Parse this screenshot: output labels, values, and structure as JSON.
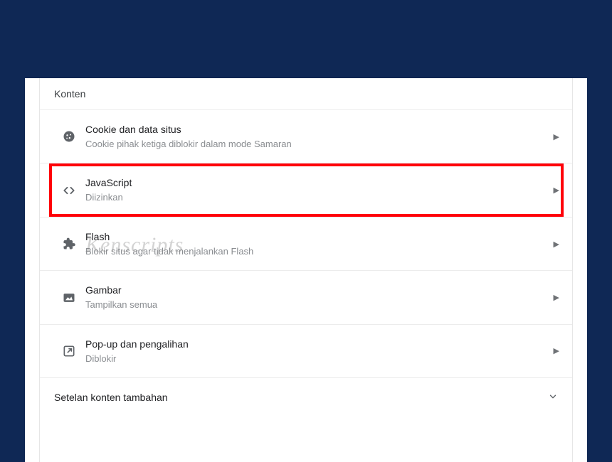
{
  "section": {
    "header": "Konten"
  },
  "items": [
    {
      "title": "Cookie dan data situs",
      "subtitle": "Cookie pihak ketiga diblokir dalam mode Samaran"
    },
    {
      "title": "JavaScript",
      "subtitle": "Diizinkan"
    },
    {
      "title": "Flash",
      "subtitle": "Blokir situs agar tidak menjalankan Flash"
    },
    {
      "title": "Gambar",
      "subtitle": "Tampilkan semua"
    },
    {
      "title": "Pop-up dan pengalihan",
      "subtitle": "Diblokir"
    }
  ],
  "more": {
    "label": "Setelan konten tambahan"
  },
  "watermark": "Kenscripts"
}
